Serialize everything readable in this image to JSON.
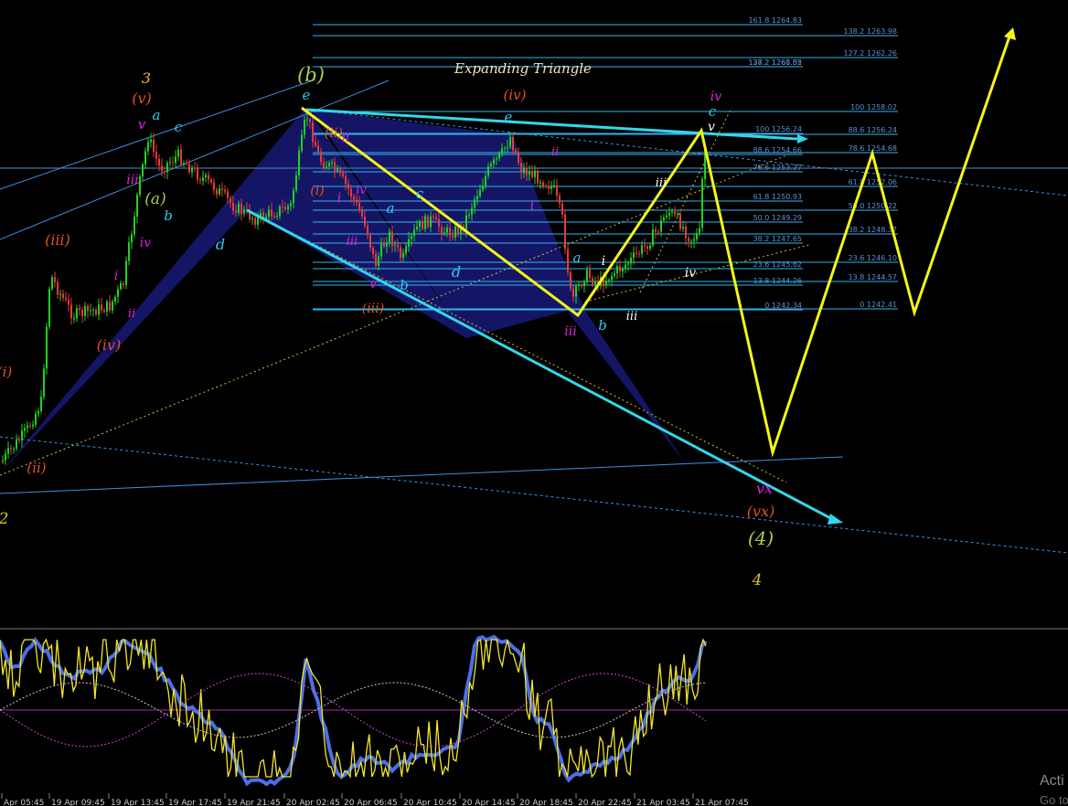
{
  "chart_data": {
    "type": "line",
    "title": "Expanding Triangle",
    "x_ticks": [
      "Apr 05:45",
      "19 Apr 09:45",
      "19 Apr 13:45",
      "19 Apr 17:45",
      "19 Apr 21:45",
      "20 Apr 02:45",
      "20 Apr 06:45",
      "20 Apr 10:45",
      "20 Apr 14:45",
      "20 Apr 18:45",
      "20 Apr 22:45",
      "21 Apr 03:45",
      "21 Apr 07:45"
    ],
    "fib_left": [
      {
        "label": "161.8",
        "value": "1264.83"
      },
      {
        "label": "138.2",
        "value": "1261.55"
      },
      {
        "label": "127.2",
        "value": "1260.02"
      },
      {
        "label": "100",
        "value": "1256.24"
      },
      {
        "label": "88.6",
        "value": "1254.66"
      },
      {
        "label": "78.6",
        "value": "1253.27"
      },
      {
        "label": "61.8",
        "value": "1250.93"
      },
      {
        "label": "50.0",
        "value": "1249.29"
      },
      {
        "label": "38.2",
        "value": "1247.65"
      },
      {
        "label": "23.6",
        "value": "1245.62"
      },
      {
        "label": "13.8",
        "value": "1244.26"
      },
      {
        "label": "0",
        "value": "1242.34"
      }
    ],
    "fib_right": [
      {
        "label": "138.2",
        "value": "1263.98"
      },
      {
        "label": "127.2",
        "value": "1262.26"
      },
      {
        "label": "100",
        "value": "1258.02"
      },
      {
        "label": "88.6",
        "value": "1256.24"
      },
      {
        "label": "78.6",
        "value": "1254.68"
      },
      {
        "label": "61.8",
        "value": "1252.06"
      },
      {
        "label": "50.0",
        "value": "1250.22"
      },
      {
        "label": "38.2",
        "value": "1248.37"
      },
      {
        "label": "23.6",
        "value": "1246.10"
      },
      {
        "label": "13.8",
        "value": "1244.57"
      },
      {
        "label": "0",
        "value": "1242.41"
      }
    ],
    "wave_labels": [
      "3",
      "(v)",
      "v",
      "a",
      "c",
      "iii",
      "(a)",
      "b",
      "iv",
      "i",
      "d",
      "(iii)",
      "ii",
      "(iv)",
      "(i)",
      "(ii)",
      "2",
      "(b)",
      "e",
      "(ii)",
      "ii",
      "(i)",
      "i",
      "iv",
      "a",
      "c",
      "iii",
      "v",
      "b",
      "(iii)",
      "d",
      "(iv)",
      "e",
      "ii",
      "i",
      "a",
      "iii",
      "b",
      "iv",
      "c",
      "v",
      "iii",
      "iv",
      "i",
      "iii",
      "vx",
      "(vx)",
      "(4)",
      "4"
    ],
    "colors": {
      "bullish_candle": "#1fd21f",
      "bearish_candle": "#e83a3a",
      "harmonic_fill": "#15176a",
      "channel": "#3d8fe0",
      "cyan_trend": "#33d7ea",
      "projection": "#f5f51a",
      "fib_line": "#35b4f0",
      "osc_blue": "#4c6fe6",
      "osc_yellow": "#f2e62c",
      "osc_dotted": "#c64cc6"
    }
  },
  "watermark": {
    "line1": "Acti",
    "line2": "Go to"
  }
}
